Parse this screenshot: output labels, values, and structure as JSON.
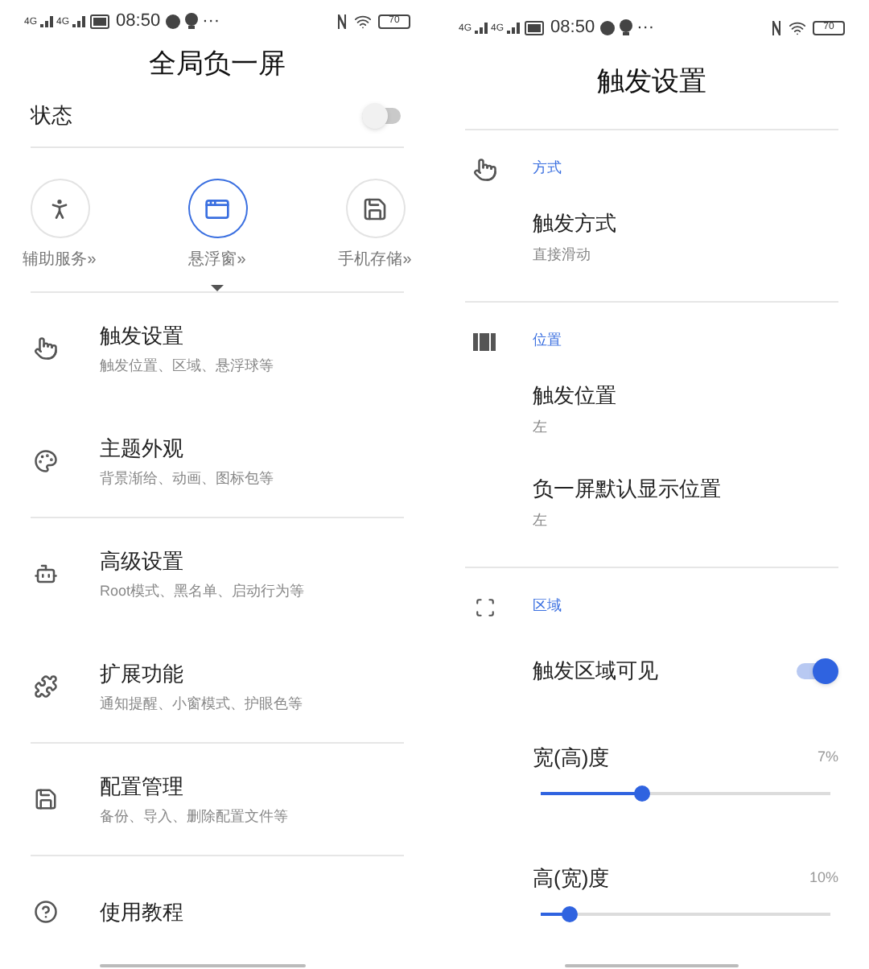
{
  "left_screen": {
    "status_bar": {
      "network_1": "4G",
      "network_2": "4G",
      "time": "08:50",
      "more": "···",
      "battery": "70"
    },
    "title": "全局负一屏",
    "status_row": {
      "label": "状态",
      "on": false
    },
    "shortcuts": [
      {
        "label": "辅助服务»",
        "selected": false
      },
      {
        "label": "悬浮窗»",
        "selected": true
      },
      {
        "label": "手机存储»",
        "selected": false
      }
    ],
    "menu": [
      {
        "title": "触发设置",
        "subtitle": "触发位置、区域、悬浮球等",
        "divider": false
      },
      {
        "title": "主题外观",
        "subtitle": "背景渐给、动画、图标包等",
        "divider": true
      },
      {
        "title": "高级设置",
        "subtitle": "Root模式、黑名单、启动行为等",
        "divider": false
      },
      {
        "title": "扩展功能",
        "subtitle": "通知提醒、小窗模式、护眼色等",
        "divider": true
      },
      {
        "title": "配置管理",
        "subtitle": "备份、导入、删除配置文件等",
        "divider": true
      },
      {
        "title": "使用教程",
        "divider": false
      }
    ]
  },
  "right_screen": {
    "status_bar": {
      "network_1": "4G",
      "network_2": "4G",
      "time": "08:50",
      "more": "···",
      "battery": "70"
    },
    "title": "触发设置",
    "sections": [
      {
        "header": "方式",
        "items": [
          {
            "kind": "text",
            "title": "触发方式",
            "value": "直接滑动"
          }
        ]
      },
      {
        "header": "位置",
        "items": [
          {
            "kind": "text",
            "title": "触发位置",
            "value": "左"
          },
          {
            "kind": "text",
            "title": "负一屏默认显示位置",
            "value": "左"
          }
        ]
      },
      {
        "header": "区域",
        "items": [
          {
            "kind": "switch",
            "title": "触发区域可见",
            "on": true
          },
          {
            "kind": "slider",
            "title": "宽(高)度",
            "reading": "7%",
            "level": 0.35
          },
          {
            "kind": "slider",
            "title": "高(宽)度",
            "reading": "10%",
            "level": 0.1
          }
        ]
      }
    ]
  }
}
